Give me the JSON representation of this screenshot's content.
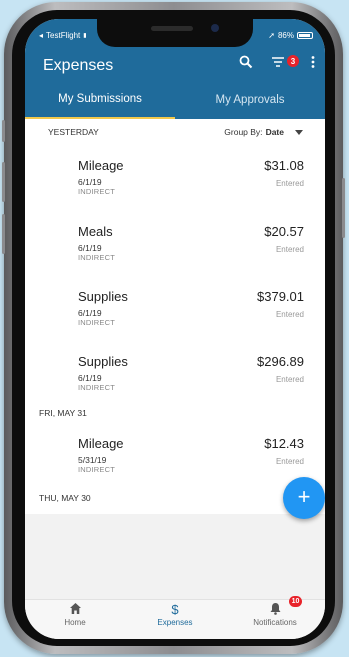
{
  "status_bar": {
    "carrier": "TestFlight",
    "battery": "86%"
  },
  "app_bar": {
    "title": "Expenses",
    "filter_count": "3",
    "icons": [
      "search-icon",
      "filter-icon",
      "more-vert-icon"
    ]
  },
  "tabs": [
    {
      "label": "My Submissions",
      "active": true
    },
    {
      "label": "My Approvals",
      "active": false
    }
  ],
  "group_by": {
    "label": "Group By:",
    "value": "Date"
  },
  "groups": [
    {
      "header": "YESTERDAY",
      "items": [
        {
          "category": "Mileage",
          "date": "6/1/19",
          "type": "INDIRECT",
          "amount": "$31.08",
          "status": "Entered"
        },
        {
          "category": "Meals",
          "date": "6/1/19",
          "type": "INDIRECT",
          "amount": "$20.57",
          "status": "Entered"
        },
        {
          "category": "Supplies",
          "date": "6/1/19",
          "type": "INDIRECT",
          "amount": "$379.01",
          "status": "Entered"
        },
        {
          "category": "Supplies",
          "date": "6/1/19",
          "type": "INDIRECT",
          "amount": "$296.89",
          "status": "Entered"
        }
      ]
    },
    {
      "header": "FRI, MAY 31",
      "items": [
        {
          "category": "Mileage",
          "date": "5/31/19",
          "type": "INDIRECT",
          "amount": "$12.43",
          "status": "Entered"
        }
      ]
    },
    {
      "header": "THU, MAY 30",
      "items": []
    }
  ],
  "fab": {
    "label": "+"
  },
  "bottom_nav": {
    "items": [
      {
        "label": "Home",
        "icon": "home-icon",
        "active": false
      },
      {
        "label": "Expenses",
        "icon": "dollar-icon",
        "active": true
      },
      {
        "label": "Notifications",
        "icon": "bell-icon",
        "active": false
      }
    ],
    "notification_count": "10"
  },
  "colors": {
    "primary": "#1f6b9b",
    "accent": "#2196f3",
    "tab_indicator": "#f2c94c",
    "badge": "#e8232a"
  }
}
